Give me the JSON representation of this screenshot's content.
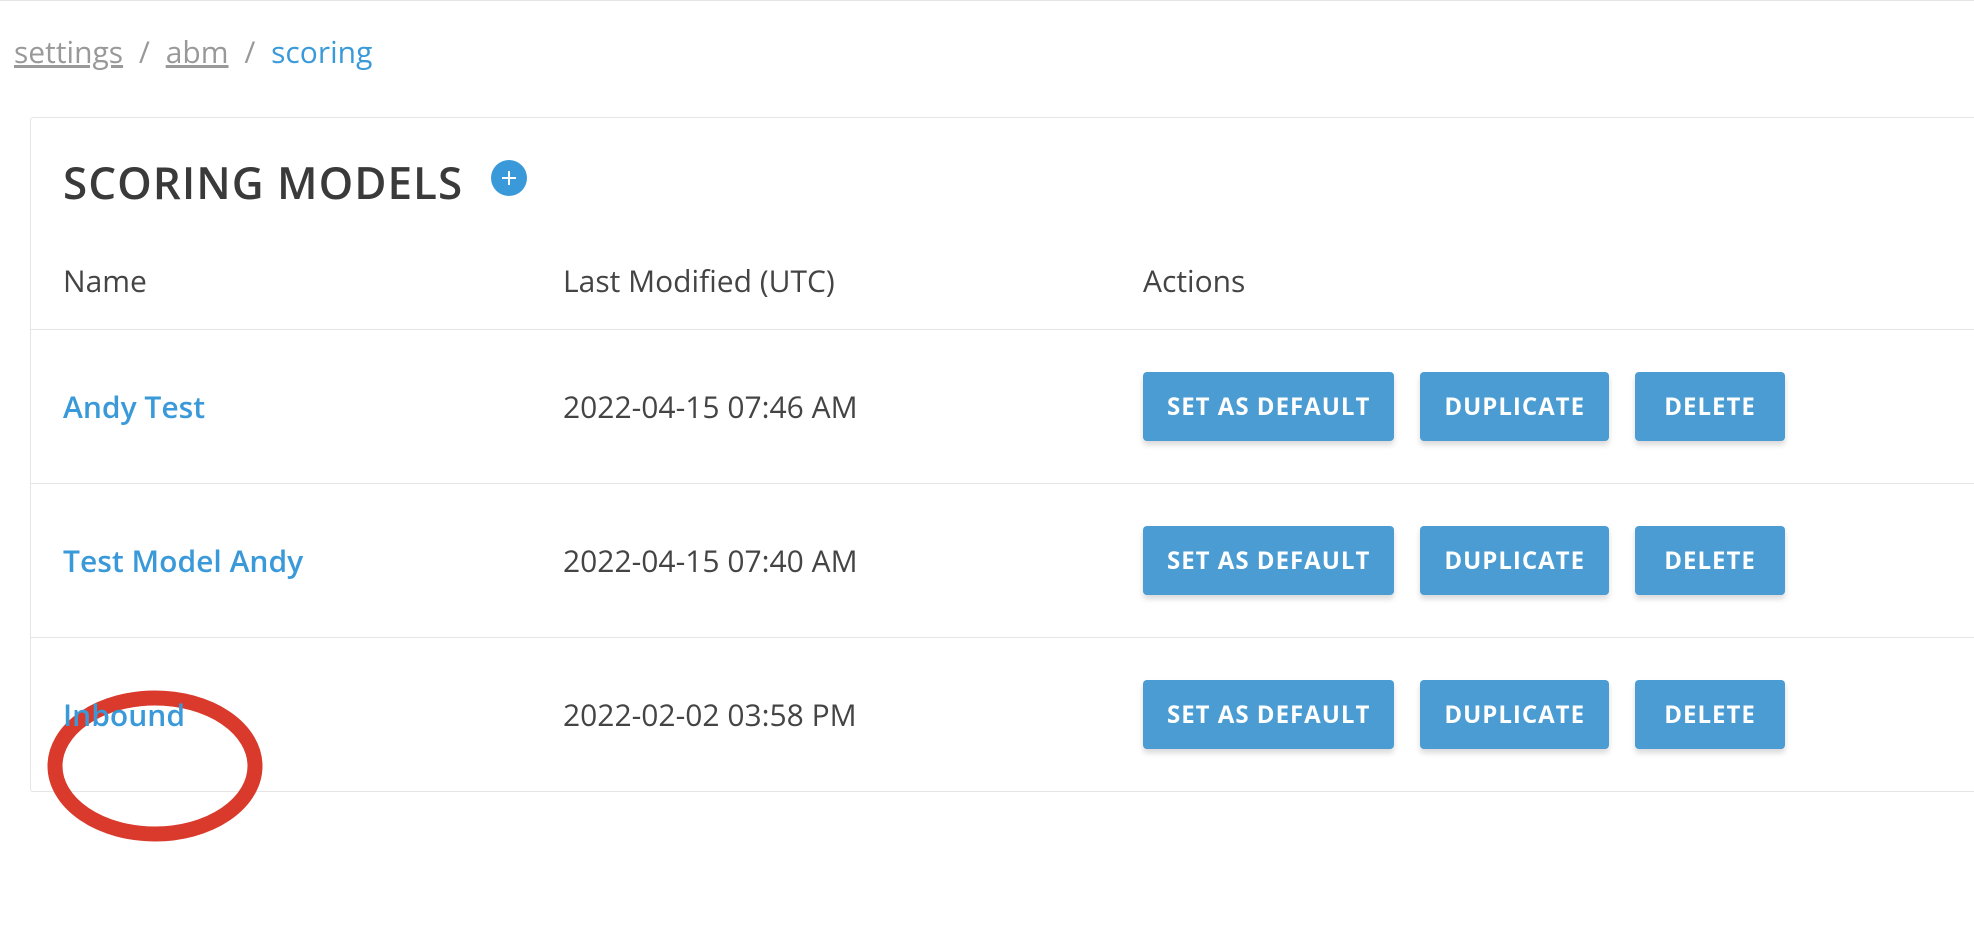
{
  "breadcrumb": {
    "item0": "settings",
    "item1": "abm",
    "current": "scoring",
    "sep": "/"
  },
  "header": {
    "title": "SCORING MODELS"
  },
  "table": {
    "columns": {
      "name": "Name",
      "modified": "Last Modified (UTC)",
      "actions": "Actions"
    },
    "rows": [
      {
        "name": "Andy Test",
        "modified": "2022-04-15 07:46 AM"
      },
      {
        "name": "Test Model Andy",
        "modified": "2022-04-15 07:40 AM"
      },
      {
        "name": "Inbound",
        "modified": "2022-02-02 03:58 PM"
      }
    ],
    "actions": {
      "setDefault": "SET AS DEFAULT",
      "duplicate": "DUPLICATE",
      "delete": "DELETE"
    }
  }
}
